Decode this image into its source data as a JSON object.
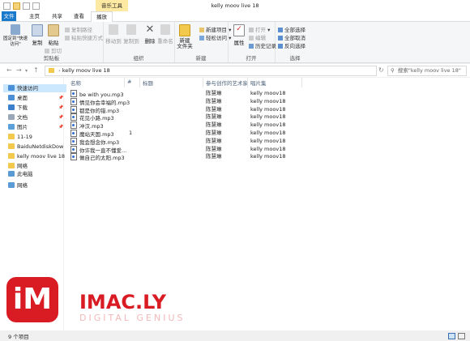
{
  "window": {
    "title": "kelly moov live 18",
    "context_tab": "音乐工具",
    "quick_access": [
      "undo-icon",
      "folder-icon",
      "checkbox-icon",
      "pin-icon"
    ]
  },
  "tabs": {
    "file": "文件",
    "home": "主页",
    "share": "共享",
    "view": "查看",
    "play": "播放"
  },
  "ribbon": {
    "clipboard": {
      "pin": "固定到\"快速访问\"",
      "copy": "复制",
      "paste": "粘贴",
      "cut": "剪切",
      "copy_path": "复制路径",
      "paste_shortcut": "粘贴快捷方式",
      "label": "剪贴板"
    },
    "organize": {
      "move_to": "移动到",
      "copy_to": "复制到",
      "delete": "删除",
      "rename": "重命名",
      "label": "组织"
    },
    "new": {
      "new_folder": "新建\n文件夹",
      "new_item": "新建项目",
      "easy_access": "轻松访问",
      "label": "新建"
    },
    "open": {
      "properties": "属性",
      "open": "打开",
      "edit": "编辑",
      "history": "历史记录",
      "label": "打开"
    },
    "select": {
      "select_all": "全部选择",
      "select_none": "全部取消",
      "invert": "反向选择",
      "label": "选择"
    }
  },
  "nav": {
    "address": "kelly moov live 18",
    "search_placeholder": "搜索\"kelly moov live 18\""
  },
  "navpane": {
    "quick_access": "快速访问",
    "items": [
      {
        "label": "桌面",
        "icon": "desktop-icon",
        "pinned": true
      },
      {
        "label": "下载",
        "icon": "download-icon",
        "pinned": true
      },
      {
        "label": "文档",
        "icon": "documents-icon",
        "pinned": true
      },
      {
        "label": "图片",
        "icon": "pictures-icon",
        "pinned": true
      },
      {
        "label": "11-19",
        "icon": "folder-icon",
        "pinned": false
      },
      {
        "label": "BaiduNetdiskDow",
        "icon": "folder-icon",
        "pinned": false
      },
      {
        "label": "kelly moov live 18",
        "icon": "folder-icon",
        "pinned": false
      },
      {
        "label": "网络",
        "icon": "folder-icon",
        "pinned": false
      }
    ],
    "this_pc": "此电脑",
    "network": "网络"
  },
  "columns": {
    "name": "名称",
    "number": "#",
    "title": "标题",
    "artist": "参与创作的艺术家",
    "album": "唱片集"
  },
  "files": [
    {
      "name": "be with you.mp3",
      "number": "",
      "artist": "陈慧琳",
      "album": "kelly moov18"
    },
    {
      "name": "情见你会幸福的.mp3",
      "number": "",
      "artist": "陈慧琳",
      "album": "kelly moov18"
    },
    {
      "name": "都是你的错.mp3",
      "number": "",
      "artist": "陈慧琳",
      "album": "kelly moov18"
    },
    {
      "name": "花见小路.mp3",
      "number": "",
      "artist": "陈慧琳",
      "album": "kelly moov18"
    },
    {
      "name": "冲汉.mp3",
      "number": "",
      "artist": "陈慧琳",
      "album": "kelly moov18"
    },
    {
      "name": "魔站天国.mp3",
      "number": "1",
      "artist": "陈慧琳",
      "album": "kelly moov18"
    },
    {
      "name": "我会想念你.mp3",
      "number": "",
      "artist": "陈慧琳",
      "album": "kelly moov18"
    },
    {
      "name": "你许我一直不懂爱...",
      "number": "",
      "artist": "陈慧琳",
      "album": "kelly moov18"
    },
    {
      "name": "做自己的太阳.mp3",
      "number": "",
      "artist": "陈慧琳",
      "album": "kelly moov18"
    }
  ],
  "status": {
    "count": "9 个项目"
  },
  "watermark": {
    "logo": "iM",
    "title": "IMAC.LY",
    "subtitle": "DIGITAL GENIUS"
  },
  "colors": {
    "accent": "#1979ca",
    "selection": "#cce8ff",
    "brand": "#d91b24"
  }
}
